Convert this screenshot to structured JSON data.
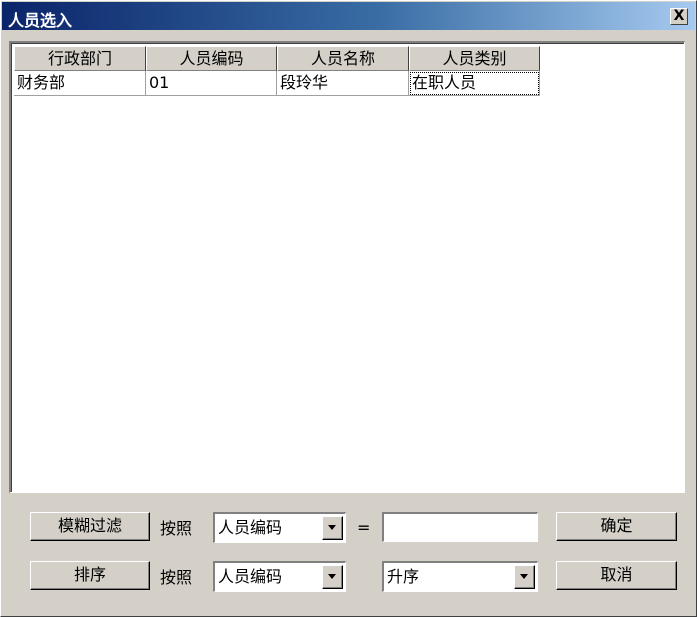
{
  "window": {
    "title": "人员选入",
    "close_glyph": "X"
  },
  "grid": {
    "columns": [
      "行政部门",
      "人员编码",
      "人员名称",
      "人员类别"
    ],
    "rows": [
      [
        "财务部",
        "01",
        "段玲华",
        "在职人员"
      ]
    ]
  },
  "filter": {
    "button_label": "模糊过滤",
    "by_label": "按照",
    "field_value": "人员编码",
    "equals": "=",
    "value": ""
  },
  "sort": {
    "button_label": "排序",
    "by_label": "按照",
    "field_value": "人员编码",
    "order_value": "升序"
  },
  "actions": {
    "ok_label": "确定",
    "cancel_label": "取消"
  }
}
